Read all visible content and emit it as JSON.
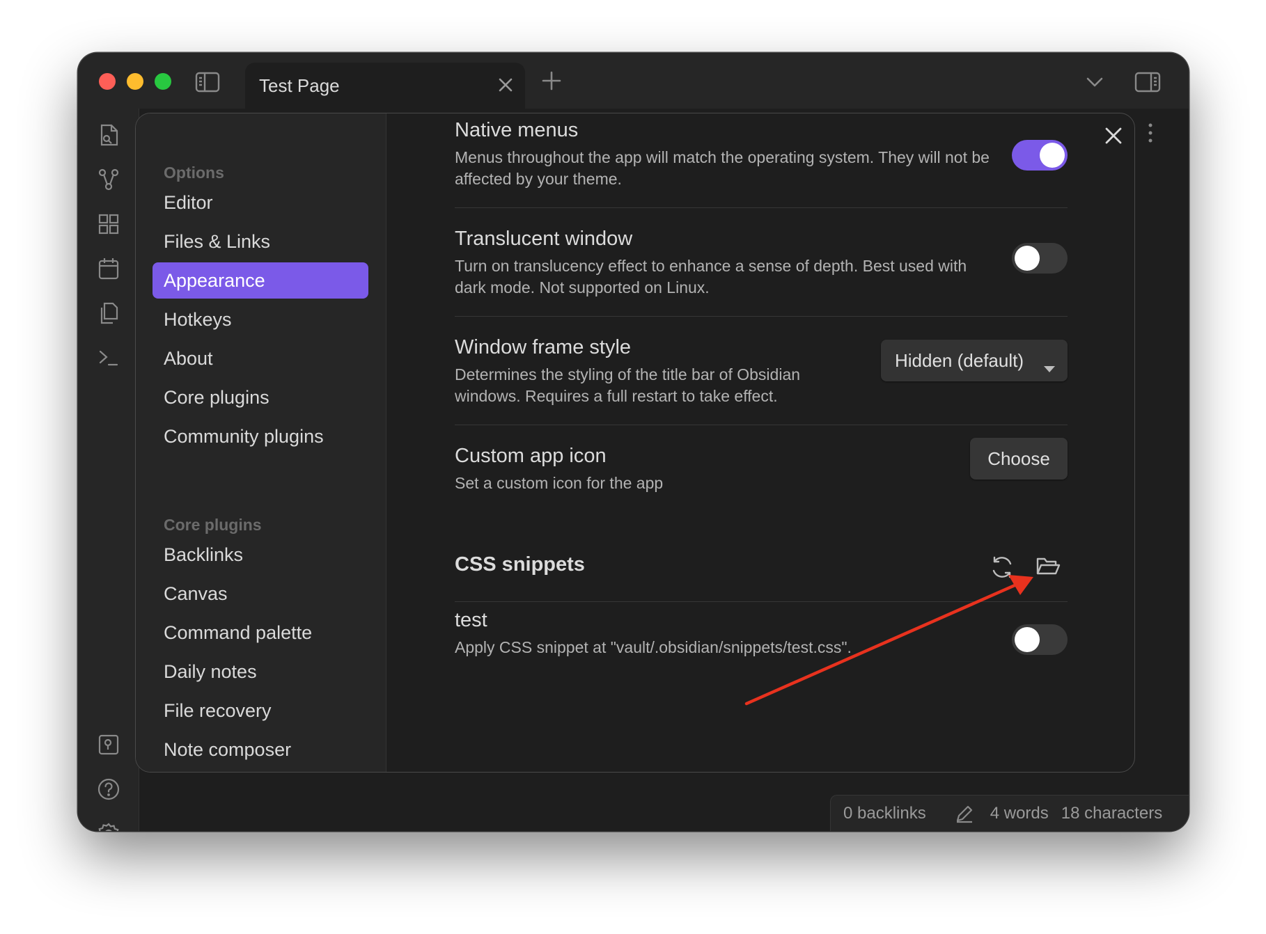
{
  "tab": {
    "title": "Test Page"
  },
  "sidebar": {
    "options_heading": "Options",
    "options": [
      {
        "label": "Editor",
        "active": false
      },
      {
        "label": "Files & Links",
        "active": false
      },
      {
        "label": "Appearance",
        "active": true
      },
      {
        "label": "Hotkeys",
        "active": false
      },
      {
        "label": "About",
        "active": false
      },
      {
        "label": "Core plugins",
        "active": false
      },
      {
        "label": "Community plugins",
        "active": false
      }
    ],
    "core_heading": "Core plugins",
    "core": [
      {
        "label": "Backlinks"
      },
      {
        "label": "Canvas"
      },
      {
        "label": "Command palette"
      },
      {
        "label": "Daily notes"
      },
      {
        "label": "File recovery"
      },
      {
        "label": "Note composer"
      }
    ]
  },
  "settings": {
    "native_menus": {
      "name": "Native menus",
      "desc": "Menus throughout the app will match the operating system. They will not be affected by your theme.",
      "enabled": true
    },
    "translucent_window": {
      "name": "Translucent window",
      "desc": "Turn on translucency effect to enhance a sense of depth. Best used with dark mode. Not supported on Linux.",
      "enabled": false
    },
    "window_frame_style": {
      "name": "Window frame style",
      "desc": "Determines the styling of the title bar of Obsidian windows. Requires a full restart to take effect.",
      "value": "Hidden (default)"
    },
    "custom_app_icon": {
      "name": "Custom app icon",
      "desc": "Set a custom icon for the app",
      "button": "Choose"
    },
    "css_snippets": {
      "title": "CSS snippets",
      "snippets": [
        {
          "name": "test",
          "desc": "Apply CSS snippet at \"vault/.obsidian/snippets/test.css\".",
          "enabled": false
        }
      ]
    }
  },
  "status": {
    "backlinks": "0 backlinks",
    "words": "4 words",
    "characters": "18 characters"
  },
  "colors": {
    "accent": "#7b5ae8",
    "annotation_arrow": "#e8321e"
  },
  "icons": {
    "titlebar": [
      "sidebar-toggle-icon",
      "close-icon",
      "plus-icon",
      "chevron-down-icon",
      "right-sidebar-icon"
    ],
    "ribbon": [
      "search-file-icon",
      "graph-icon",
      "dashboard-icon",
      "calendar-icon",
      "copy-icon",
      "terminal-icon",
      "vault-icon",
      "help-icon",
      "gear-icon"
    ],
    "css_snippets": [
      "reload-icon",
      "folder-open-icon"
    ]
  }
}
